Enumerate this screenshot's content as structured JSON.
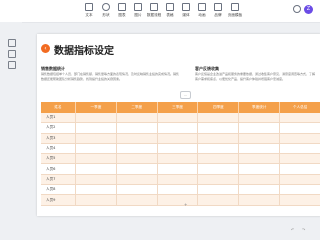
{
  "toolbar": {
    "items": [
      {
        "label": "文本",
        "icon": "text-icon"
      },
      {
        "label": "形状",
        "icon": "shape-icon"
      },
      {
        "label": "图表",
        "icon": "chart-icon"
      },
      {
        "label": "图片",
        "icon": "image-icon"
      },
      {
        "label": "数据流程",
        "icon": "flow-icon"
      },
      {
        "label": "表格",
        "icon": "table-icon"
      },
      {
        "label": "媒体",
        "icon": "media-icon"
      },
      {
        "label": "动画",
        "icon": "animation-icon"
      },
      {
        "label": "品牌",
        "icon": "brand-icon"
      },
      {
        "label": "页面模板",
        "icon": "template-icon"
      }
    ],
    "avatar_letter": "Z"
  },
  "slide": {
    "title": "数据指标设定",
    "section_left": {
      "heading": "销售数据统计",
      "text": "销售数据包括单个人员、部门在销售额、销售量等方面的表现情况，及时反映销售业绩的完成情况。销售数据还能帮助团队分析销售趋势，找到提升业绩的关键因素。"
    },
    "section_right": {
      "heading": "客户反馈收集",
      "text": "客户反馈是企业改进产品和服务的重要依据，通过收集客户意见、满意度调查等方式，了解客户需求和痛点，以便优化产品、提升客户体验并增强客户忠诚度。"
    },
    "handle_label": "…",
    "table": {
      "headers": [
        "姓名",
        "一季度",
        "二季度",
        "三季度",
        "四季度",
        "季度统计",
        "个人总结"
      ],
      "rows": [
        [
          "人员1",
          "",
          "",
          "",
          "",
          "",
          ""
        ],
        [
          "人员2",
          "",
          "",
          "",
          "",
          "",
          ""
        ],
        [
          "人员3",
          "",
          "",
          "",
          "",
          "",
          ""
        ],
        [
          "人员4",
          "",
          "",
          "",
          "",
          "",
          ""
        ],
        [
          "人员5",
          "",
          "",
          "",
          "",
          "",
          ""
        ],
        [
          "人员6",
          "",
          "",
          "",
          "",
          "",
          ""
        ],
        [
          "人员7",
          "",
          "",
          "",
          "",
          "",
          ""
        ],
        [
          "人员8",
          "",
          "",
          "",
          "",
          "",
          ""
        ],
        [
          "人员9",
          "",
          "",
          "",
          "",
          "",
          ""
        ]
      ]
    }
  },
  "colors": {
    "accent": "#f26b21",
    "table_header": "#f4a04a",
    "row_stripe": "#fdf1e6"
  }
}
